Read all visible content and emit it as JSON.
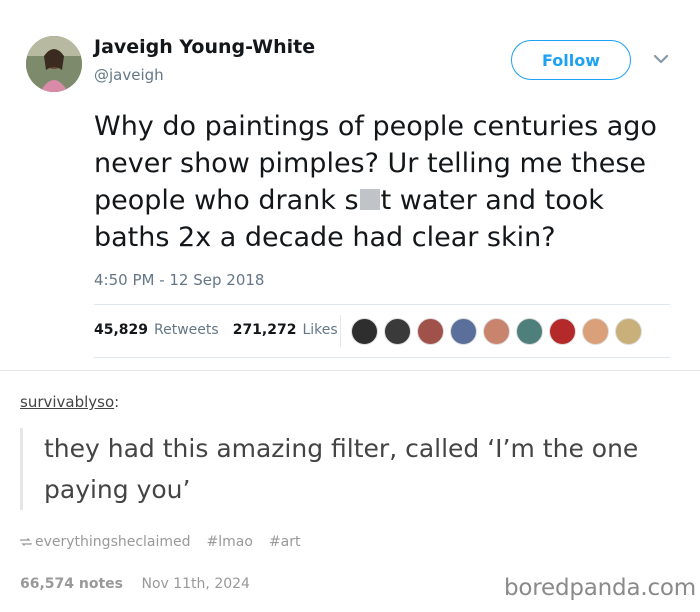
{
  "tweet": {
    "author_name": "Javeigh Young-White",
    "handle": "@javeigh",
    "follow_label": "Follow",
    "text_before": "Why do paintings of people centuries ago never show pimples? Ur telling me these people who drank s",
    "text_after": "t water and took baths 2x a decade had clear skin?",
    "timestamp": "4:50 PM - 12 Sep 2018",
    "retweets_count": "45,829",
    "retweets_label": "Retweets",
    "likes_count": "271,272",
    "likes_label": "Likes",
    "accent_color": "#1da1f2",
    "liker_avatar_colors": [
      "#2e2e2e",
      "#3a3a3a",
      "#a0524a",
      "#5a6f99",
      "#c9846e",
      "#4e7f7a",
      "#b42a2a",
      "#d9a07a",
      "#c9b07a"
    ]
  },
  "tumblr": {
    "username": "survivablyso",
    "colon": ":",
    "reply": "they had this amazing filter, called ‘I’m the one paying you’",
    "reblog_source": "everythingsheclaimed",
    "tags": [
      "#lmao",
      "#art"
    ],
    "notes_count": "66,574 notes",
    "date": "Nov 11th, 2024"
  },
  "watermark": "boredpanda.com"
}
